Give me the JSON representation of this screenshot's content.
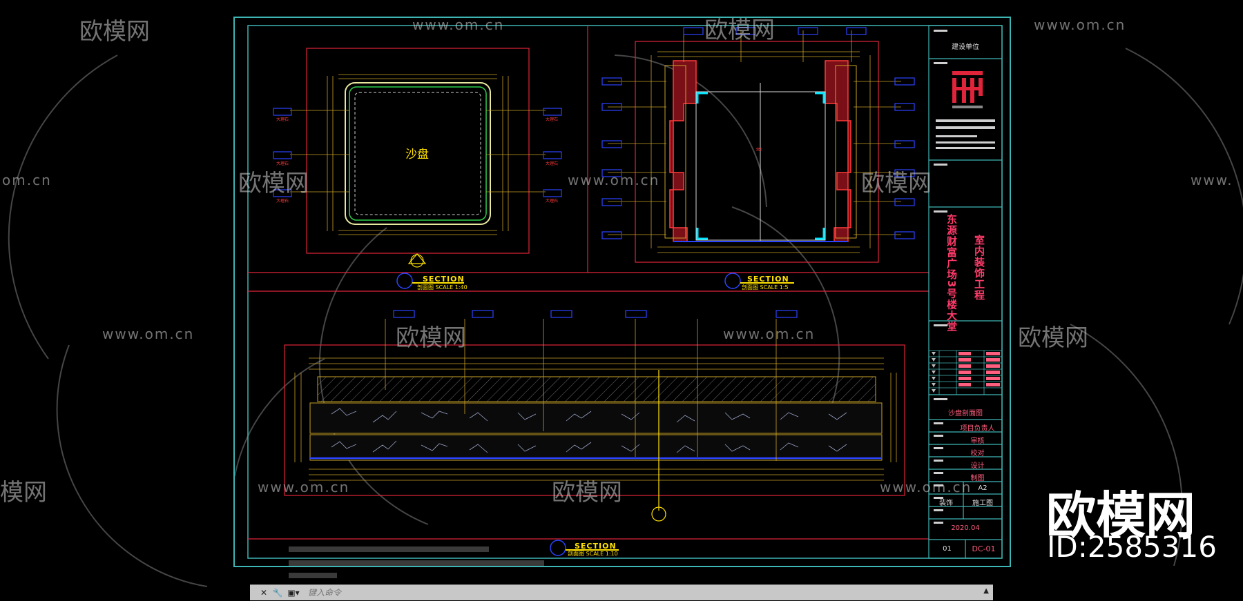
{
  "watermark": {
    "brand": "欧模网",
    "url": "www.om.cn",
    "url_fragment_left": "om.cn",
    "url_fragment_right": "www.",
    "brand_fragment": "模网",
    "big_brand": "欧模网",
    "id_text": "ID:2585316"
  },
  "drawing": {
    "sand_table_label": "沙盘",
    "sections": [
      {
        "marker": "①",
        "title": "SECTION",
        "sub": "剖面图   SCALE 1:40"
      },
      {
        "marker": "B",
        "title": "SECTION",
        "sub": "剖面图   SCALE 1:5"
      },
      {
        "marker": "A",
        "title": "SECTION",
        "sub": "剖面图   SCALE 1:10"
      }
    ],
    "tag_labels": [
      "不锈钢",
      "大理石",
      "木饰面",
      "暗藏灯带"
    ]
  },
  "title_block": {
    "client_label": "建设单位",
    "company_lines": [
      "安徽省方舟空间设计工程有限公司"
    ],
    "project_title_line1": "东源财富广场3号楼大堂",
    "project_title_line2": "室内装饰工程",
    "drawing_name": "沙盘剖面图",
    "roles": [
      "项目负责人",
      "审核",
      "校对",
      "设计",
      "制图"
    ],
    "sheet_size": "A2",
    "phase_left": "装饰",
    "phase_right": "施工图",
    "date": "2020.04",
    "sheet_no_left": "01",
    "sheet_no": "DC-01"
  },
  "command_line": {
    "placeholder": "键入命令"
  },
  "colors": {
    "frame": "#3fb6b6",
    "red_line": "#e0243a",
    "yellow": "#ffe100",
    "blue": "#2b44ff",
    "cyan": "#00e5ff",
    "magenta": "#ff3b6a"
  }
}
